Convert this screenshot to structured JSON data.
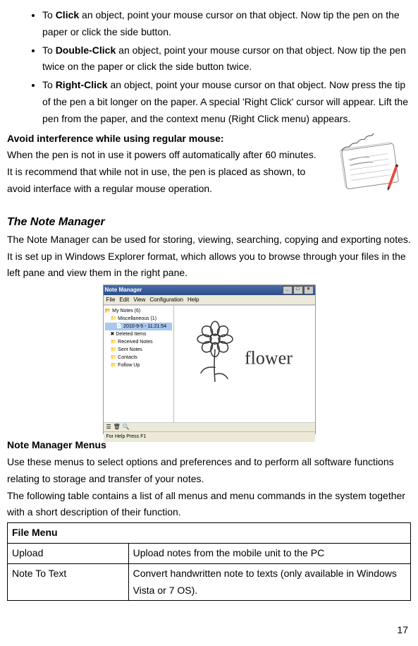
{
  "bullets": [
    {
      "prefix": "To ",
      "cmd": "Click",
      "rest": " an object, point your mouse cursor on that object. Now tip the pen on the paper or click the side button."
    },
    {
      "prefix": "To ",
      "cmd": "Double-Click",
      "rest": " an object, point your mouse cursor on that object. Now tip the pen twice on the paper or click the side button twice."
    },
    {
      "prefix": "To ",
      "cmd": "Right-Click",
      "rest": " an object, point your mouse cursor on that object. Now press the tip of the pen a bit longer on the paper. A special 'Right Click' cursor will appear. Lift the pen from the paper, and the context menu (Right Click menu) appears."
    }
  ],
  "avoid_heading": "Avoid interference while using regular mouse:",
  "avoid_p1": "When the pen is not in use it powers off automatically after 60 minutes.",
  "avoid_p2": "It is recommend that while not in use, the pen is placed as shown, to avoid interface with a regular mouse operation.",
  "nm_heading": "The Note Manager",
  "nm_p1": "The Note Manager can be used for storing, viewing, searching, copying and exporting notes.",
  "nm_p2": "It is set up in Windows Explorer format, which allows you to browse through your files in the left pane and view them in the right pane.",
  "nm_screenshot": {
    "title": "Note Manager",
    "menus": [
      "File",
      "Edit",
      "View",
      "Configuration",
      "Help"
    ],
    "tree": {
      "root": "My Notes (6)",
      "items": [
        "Miscellaneous (1)",
        "2010-9-5 - 11:21:54",
        "Deleted Items",
        "Received Notes",
        "Sent Notes",
        "Contacts",
        "Follow Up"
      ]
    },
    "canvas_word": "flower",
    "toolbar_icons": [
      "☰",
      "🗑",
      "🔍"
    ],
    "status": "For Help Press F1"
  },
  "nm_menus_heading": "Note Manager Menus",
  "nm_menus_p1": "Use these menus to select options and preferences and to perform all software functions relating to storage and transfer of your notes.",
  "nm_menus_p2": "The following table contains a list of all menus and menu commands in the system together with a short description of their function.",
  "table": {
    "header": "File Menu",
    "rows": [
      {
        "name": "Upload",
        "desc": "Upload notes from the mobile unit to the PC"
      },
      {
        "name": "Note To Text",
        "desc": "Convert handwritten note to texts (only available in Windows Vista or 7 OS)."
      }
    ]
  },
  "page_number": "17"
}
